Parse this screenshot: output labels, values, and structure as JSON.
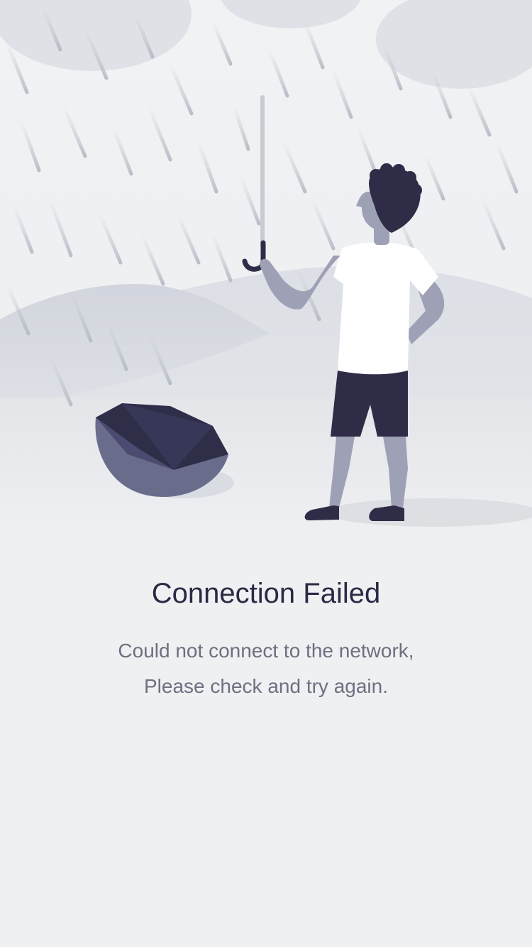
{
  "illustration": {
    "icon": "rain-broken-umbrella-illustration"
  },
  "error": {
    "title": "Connection Failed",
    "message_line1": "Could not connect to the network,",
    "message_line2": "Please check and try again."
  },
  "colors": {
    "background": "#eff0f2",
    "title": "#2b2a45",
    "message": "#6e6f80",
    "accent_dark": "#2e2c46"
  }
}
